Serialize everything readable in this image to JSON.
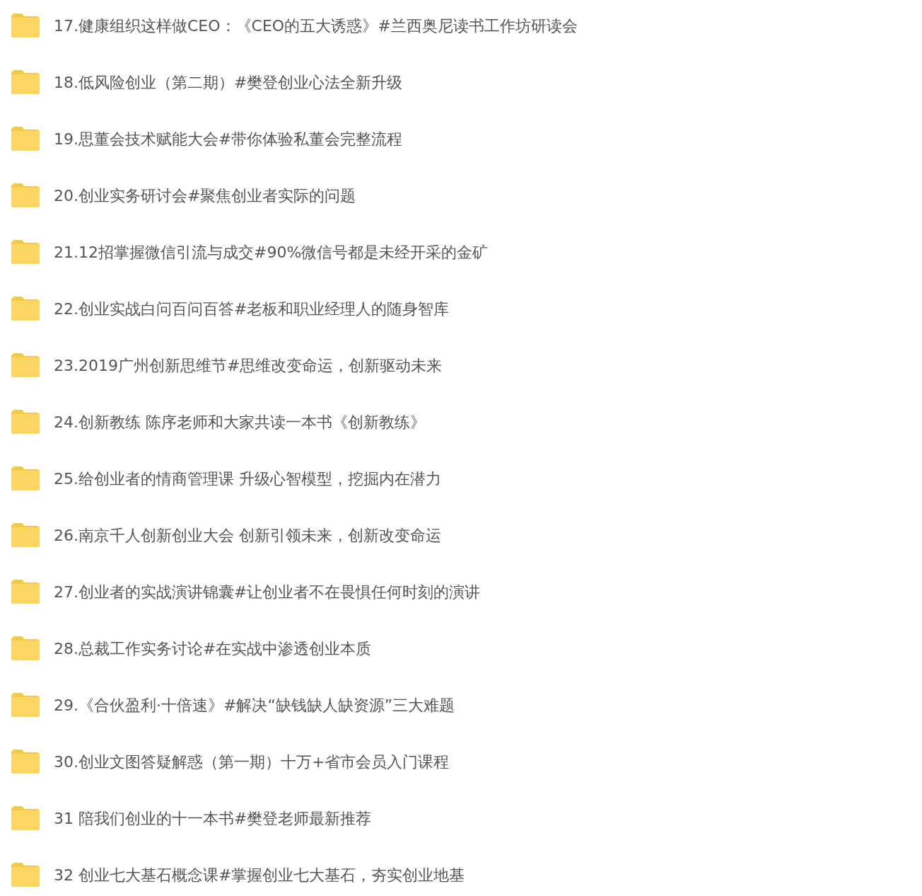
{
  "folders": [
    {
      "name": "17.健康组织这样做CEO：《CEO的五大诱惑》#兰西奥尼读书工作坊研读会"
    },
    {
      "name": "18.低风险创业（第二期）#樊登创业心法全新升级"
    },
    {
      "name": "19.思董会技术赋能大会#带你体验私董会完整流程"
    },
    {
      "name": "20.创业实务研讨会#聚焦创业者实际的问题"
    },
    {
      "name": "21.12招掌握微信引流与成交#90%微信号都是未经开采的金矿"
    },
    {
      "name": "22.创业实战白问百问百答#老板和职业经理人的随身智库"
    },
    {
      "name": "23.2019广州创新思维节#思维改变命运，创新驱动未来"
    },
    {
      "name": "24.创新教练 陈序老师和大家共读一本书《创新教练》"
    },
    {
      "name": "25.给创业者的情商管理课 升级心智模型，挖掘内在潜力"
    },
    {
      "name": "26.南京千人创新创业大会 创新引领未来，创新改变命运"
    },
    {
      "name": "27.创业者的实战演讲锦囊#让创业者不在畏惧任何时刻的演讲"
    },
    {
      "name": "28.总裁工作实务讨论#在实战中渗透创业本质"
    },
    {
      "name": "29.《合伙盈利·十倍速》#解决“缺钱缺人缺资源”三大难题"
    },
    {
      "name": "30.创业文图答疑解惑（第一期）十万+省市会员入门课程"
    },
    {
      "name": "31 陪我们创业的十一本书#樊登老师最新推荐"
    },
    {
      "name": "32 创业七大基石概念课#掌握创业七大基石，夯实创业地基"
    }
  ]
}
